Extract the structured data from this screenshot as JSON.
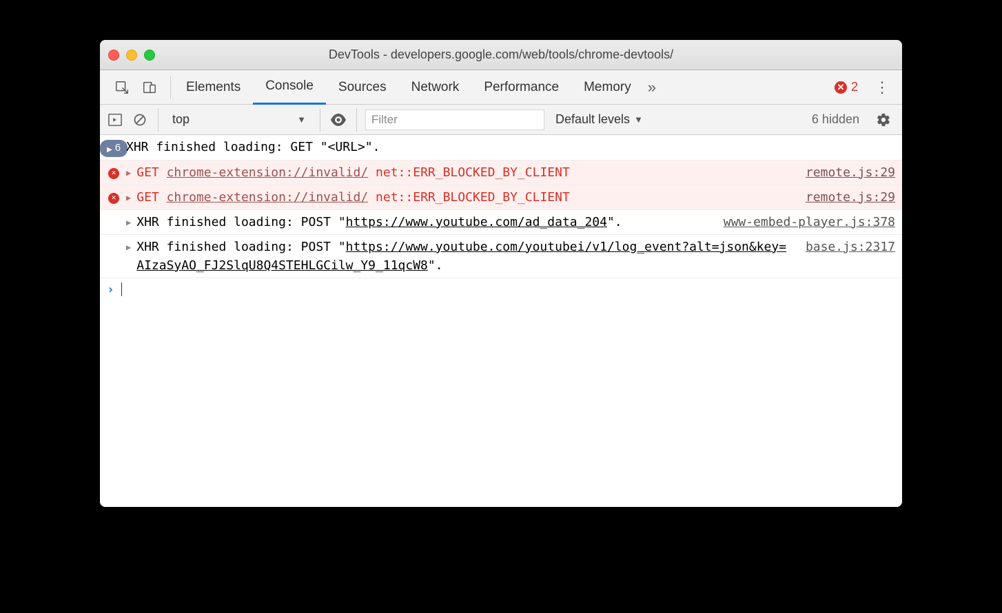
{
  "window": {
    "title": "DevTools - developers.google.com/web/tools/chrome-devtools/"
  },
  "tabs": {
    "items": [
      "Elements",
      "Console",
      "Sources",
      "Network",
      "Performance",
      "Memory"
    ],
    "active_index": 1,
    "error_count": "2"
  },
  "toolbar": {
    "context": "top",
    "filter_placeholder": "Filter",
    "levels_label": "Default levels",
    "hidden_label": "6 hidden"
  },
  "console": {
    "rows": [
      {
        "type": "info-pill",
        "pill_count": "6",
        "text": "XHR finished loading: GET \"<URL>\"."
      },
      {
        "type": "error",
        "method": "GET",
        "url": "chrome-extension://invalid/",
        "errcode": "net::ERR_BLOCKED_BY_CLIENT",
        "source": "remote.js:29"
      },
      {
        "type": "error",
        "method": "GET",
        "url": "chrome-extension://invalid/",
        "errcode": "net::ERR_BLOCKED_BY_CLIENT",
        "source": "remote.js:29"
      },
      {
        "type": "log",
        "prefix": "XHR finished loading: POST \"",
        "url": "https://www.youtube.com/ad_data_204",
        "suffix": "\".",
        "source": "www-embed-player.js:378"
      },
      {
        "type": "log",
        "prefix": "XHR finished loading: POST \"",
        "url": "https://www.youtube.com/youtubei/v1/log_event?alt=json&key=AIzaSyAO_FJ2SlqU8Q4STEHLGCilw_Y9_11qcW8",
        "suffix": "\".",
        "source": "base.js:2317"
      }
    ]
  }
}
